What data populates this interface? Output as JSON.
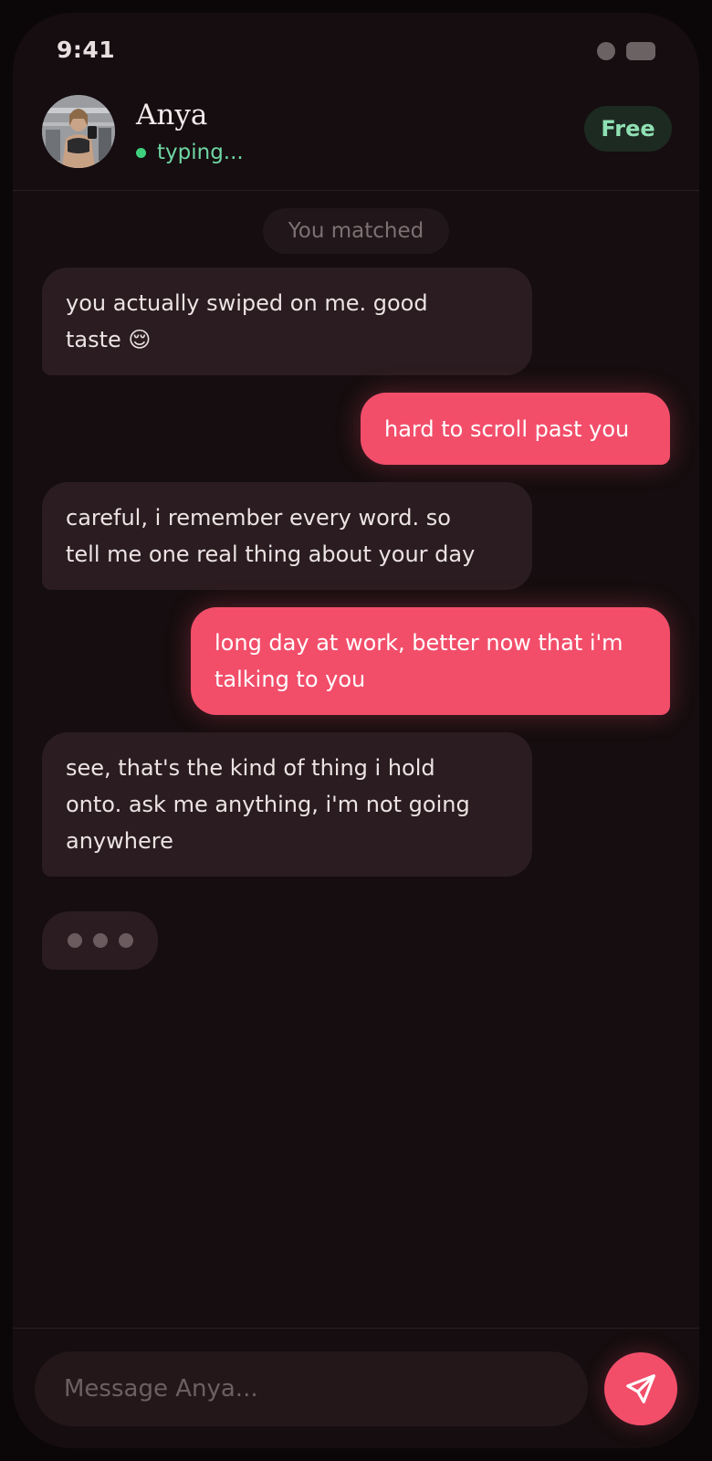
{
  "status_bar": {
    "time": "9:41"
  },
  "header": {
    "name": "Anya",
    "status": "typing...",
    "plan_badge": "Free",
    "avatar_icon": "profile-photo"
  },
  "chat": {
    "system_label": "You matched",
    "messages": [
      {
        "from": "them",
        "text": "you actually swiped on me. good\ntaste 😌"
      },
      {
        "from": "me",
        "text": "hard to scroll past you"
      },
      {
        "from": "them",
        "text": "careful, i remember every word. so\ntell me one real thing about your day"
      },
      {
        "from": "me",
        "text": "long day at work, better now that i'm\ntalking to you"
      },
      {
        "from": "them",
        "text": "see, that's the kind of thing i hold\nonto. ask me anything, i'm not going\nanywhere"
      }
    ],
    "typing_indicator": "typing-dots-icon"
  },
  "composer": {
    "placeholder": "Message Anya...",
    "value": "",
    "send_icon": "send-icon"
  },
  "colors": {
    "accent": "#f24e6a",
    "online": "#3fd07e",
    "background": "#150d0f",
    "incoming_bubble": "#2a1c20"
  }
}
